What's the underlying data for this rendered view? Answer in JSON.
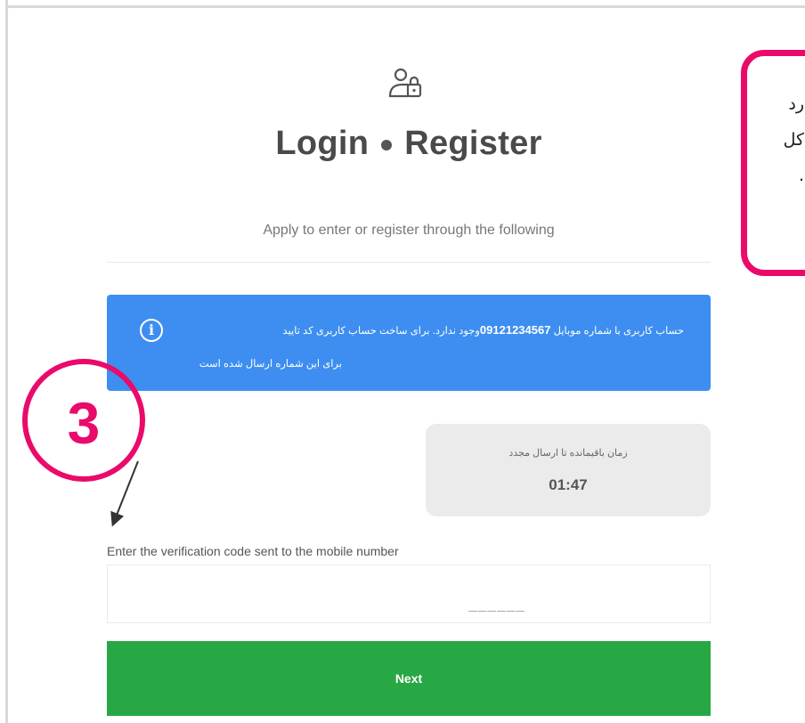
{
  "header": {
    "icon": "user-lock-icon",
    "title_login": "Login",
    "title_register": "Register",
    "subtitle": "Apply to enter or register through the following"
  },
  "alert": {
    "line1_before": "حساب کاربری با شماره موبایل ",
    "phone": "09121234567",
    "line1_after": "وجود ندارد. برای ساخت حساب کاربری کد تایید",
    "line2": "برای این شماره ارسال شده است",
    "icon": "info-icon",
    "color": "#3d8ef0"
  },
  "timer": {
    "label": "زمان باقیمانده تا ارسال مجدد",
    "value": "01:47"
  },
  "form": {
    "code_label": "Enter the verification code sent to the mobile number",
    "code_placeholder": "______",
    "next_label": "Next",
    "next_color": "#28a745"
  },
  "annotation": {
    "step_number": "3",
    "callout_text": "رد\nکل\n.",
    "accent_color": "#ea0a6a"
  }
}
